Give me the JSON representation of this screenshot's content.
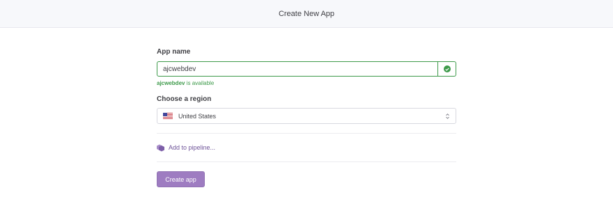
{
  "header": {
    "title": "Create New App"
  },
  "form": {
    "app_name_label": "App name",
    "app_name_value": "ajcwebdev",
    "availability_name": "ajcwebdev",
    "availability_suffix": " is available",
    "region_label": "Choose a region",
    "region_selected": "United States",
    "pipeline_label": "Add to pipeline...",
    "create_button": "Create app"
  },
  "icons": {
    "check": "check-circle-icon",
    "flag": "us-flag-icon",
    "select": "chevron-up-down-icon",
    "pipeline": "pipeline-icon"
  },
  "colors": {
    "success": "#3d9a4a",
    "accent": "#9e7cc1",
    "link": "#6f5499"
  }
}
